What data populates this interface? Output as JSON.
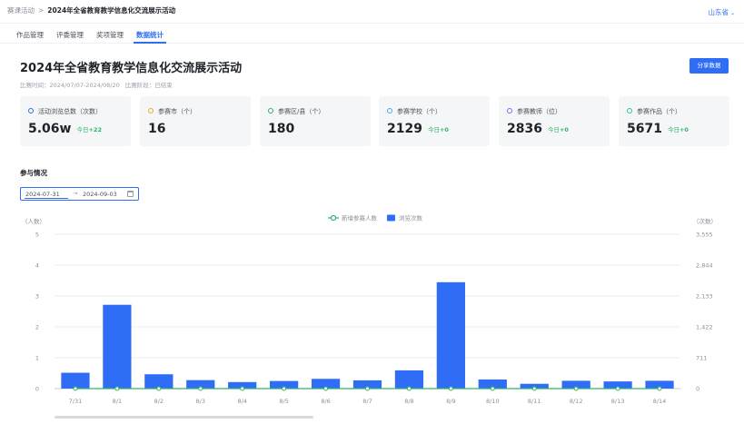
{
  "breadcrumb": {
    "parent": "赛课活动",
    "separator": ">",
    "current": "2024年全省教育教学信息化交流展示活动"
  },
  "region_selector": {
    "value": "山东省"
  },
  "tabs": [
    {
      "label": "作品管理",
      "active": false
    },
    {
      "label": "评委管理",
      "active": false
    },
    {
      "label": "奖项管理",
      "active": false
    },
    {
      "label": "数据统计",
      "active": true
    }
  ],
  "page": {
    "title": "2024年全省教育教学信息化交流展示活动",
    "time_label": "比赛时间：",
    "time_value": "2024/07/07-2024/08/20",
    "stage_label": "比赛阶段：",
    "stage_value": "已结束",
    "share_button": "分享数据"
  },
  "stats": [
    {
      "label": "活动浏览总数（次数）",
      "value": "5.06w",
      "delta_label": "今日",
      "delta": "+22",
      "color": "#2f6df6"
    },
    {
      "label": "参赛市（个）",
      "value": "16",
      "delta_label": "",
      "delta": "",
      "color": "#f5a623"
    },
    {
      "label": "参赛区/县（个）",
      "value": "180",
      "delta_label": "",
      "delta": "",
      "color": "#2fb36b"
    },
    {
      "label": "参赛学校（个）",
      "value": "2129",
      "delta_label": "今日",
      "delta": "+0",
      "color": "#4aa8f0"
    },
    {
      "label": "参赛教师（位）",
      "value": "2836",
      "delta_label": "今日",
      "delta": "+0",
      "color": "#7b6cf0"
    },
    {
      "label": "参赛作品（个）",
      "value": "5671",
      "delta_label": "今日",
      "delta": "+0",
      "color": "#2fc0a8"
    }
  ],
  "participation": {
    "section_title": "参与情况",
    "date_start": "2024-07-31",
    "date_arrow": "→",
    "date_end": "2024-09-03"
  },
  "colors": {
    "accent": "#2f6df6",
    "positive": "#2fb36b",
    "line": "#2fb36b",
    "bar": "#2f6df6"
  },
  "chart_data": {
    "type": "bar",
    "categories": [
      "7/31",
      "8/1",
      "8/2",
      "8/3",
      "8/4",
      "8/5",
      "8/6",
      "8/7",
      "8/8",
      "8/9",
      "8/10",
      "8/11",
      "8/12",
      "8/13",
      "8/14"
    ],
    "series": [
      {
        "name": "新增参赛人数",
        "type": "line",
        "axis": "left",
        "values": [
          0,
          0,
          0,
          0,
          0,
          0,
          0,
          0,
          0,
          0,
          0,
          0,
          0,
          0,
          0
        ]
      },
      {
        "name": "浏览次数",
        "type": "bar",
        "axis": "right",
        "values": [
          365,
          1930,
          330,
          195,
          150,
          175,
          225,
          190,
          420,
          2450,
          210,
          110,
          180,
          165,
          180
        ]
      }
    ],
    "ylabel_left": "（人数）",
    "ylabel_right": "（次数）",
    "left_ticks": [
      "0",
      "1",
      "2",
      "3",
      "4",
      "5"
    ],
    "right_ticks": [
      "0",
      "711",
      "1,422",
      "2,133",
      "2,844",
      "3,555"
    ],
    "ylim_left": [
      0,
      5
    ],
    "ylim_right": [
      0,
      3555
    ],
    "legend_position": "top-center",
    "grid": true
  }
}
